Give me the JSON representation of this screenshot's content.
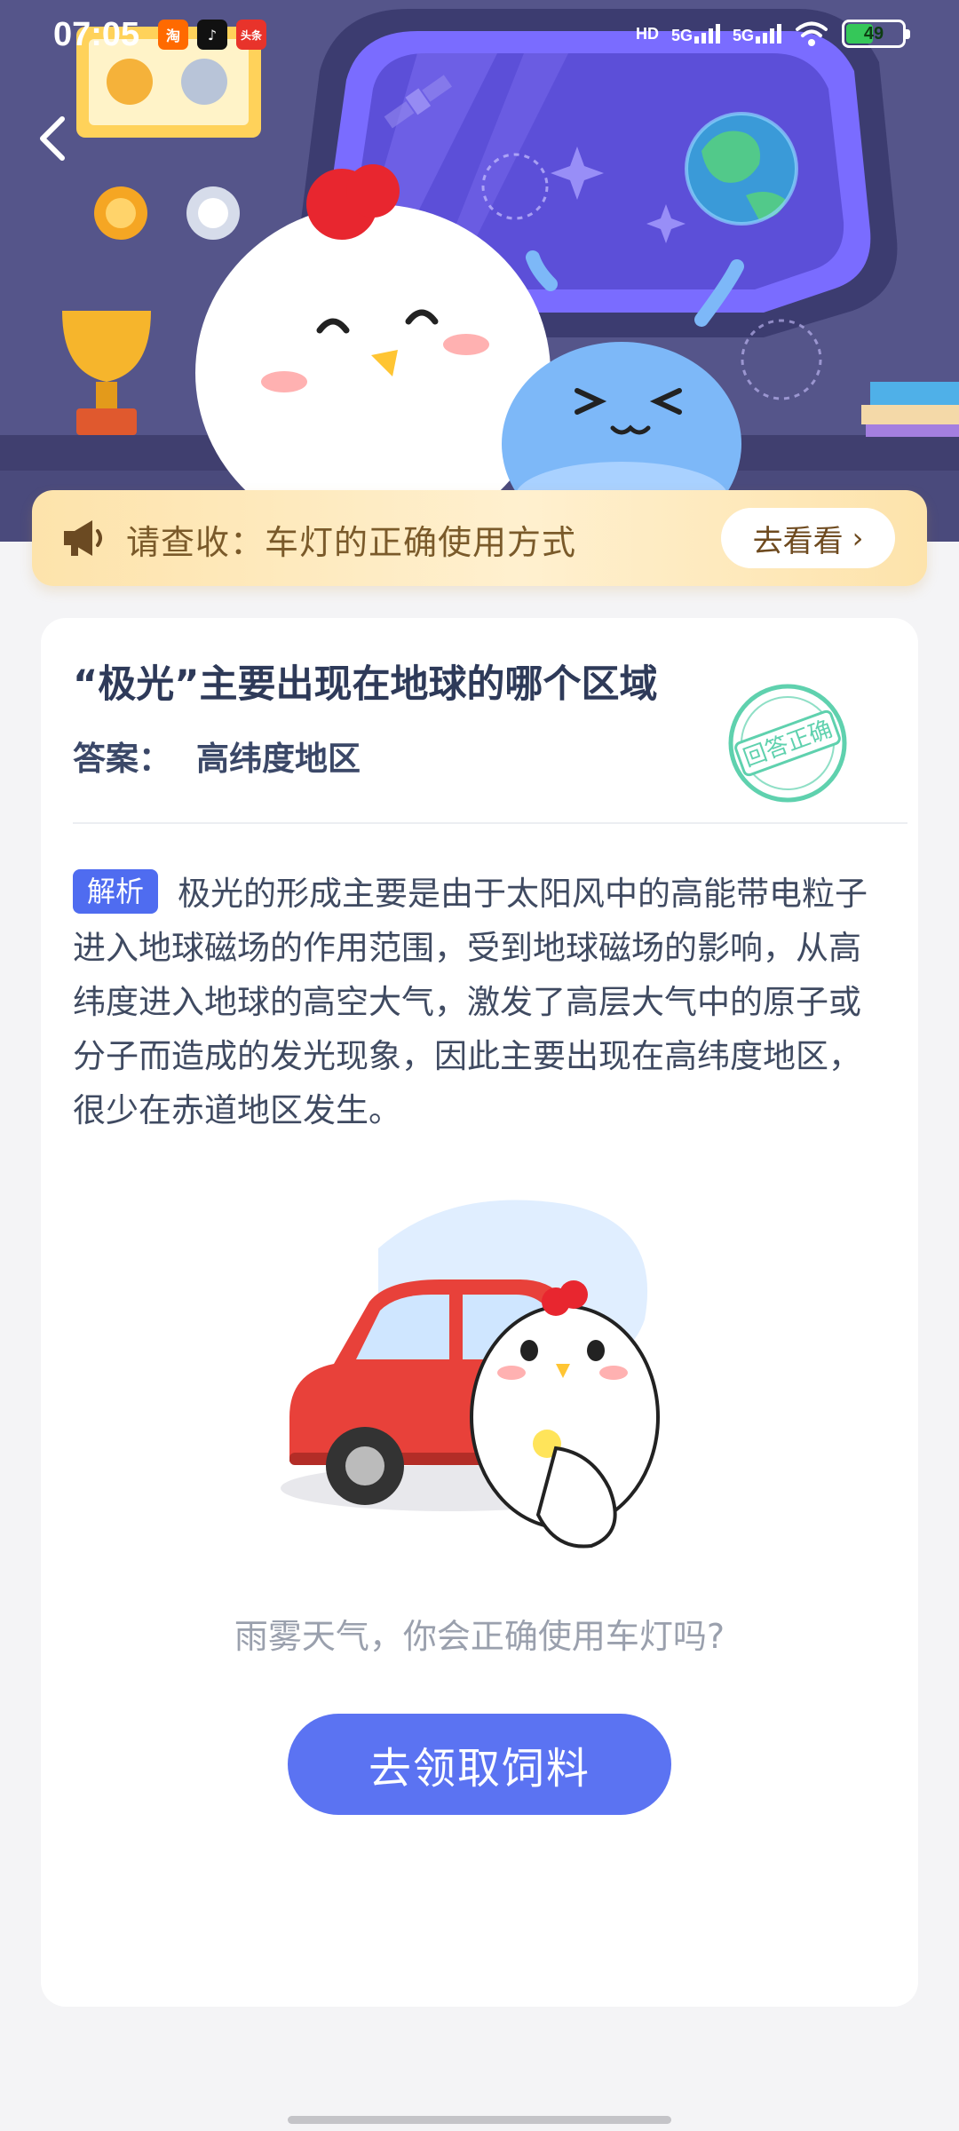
{
  "status_bar": {
    "time": "07:05",
    "apps": [
      {
        "name": "taobao",
        "label": "淘",
        "color": "#ff6a00"
      },
      {
        "name": "tiktok",
        "label": "♪",
        "color": "#111111"
      },
      {
        "name": "toutiao",
        "label": "头条",
        "color": "#e8332b"
      }
    ],
    "network_1": "HD",
    "network_2": "5G",
    "network_3": "5G",
    "battery": "49",
    "battery_level": 0.49
  },
  "notice": {
    "text": "请查收：车灯的正确使用方式",
    "button_label": "去看看",
    "button_chevron": "›"
  },
  "question": {
    "title": "“极光”主要出现在地球的哪个区域",
    "answer_label": "答案：",
    "answer_value": "高纬度地区",
    "stamp_text": "回答正确"
  },
  "analysis": {
    "tag": "解析",
    "text": "极光的形成主要是由于太阳风中的高能带电粒子进入地球磁场的作用范围，受到地球磁场的影响，从高纬度进入地球的高空大气，激发了高层大气中的原子或分子而造成的发光现象，因此主要出现在高纬度地区，很少在赤道地区发生。"
  },
  "promo": {
    "subtitle": "雨雾天气，你会正确使用车灯吗?",
    "cta_label": "去领取饲料"
  },
  "colors": {
    "accent": "#5b73f2",
    "tag": "#4f6cf0",
    "stamp": "#5fd1ae",
    "notice_bg": "#fde3ab"
  }
}
